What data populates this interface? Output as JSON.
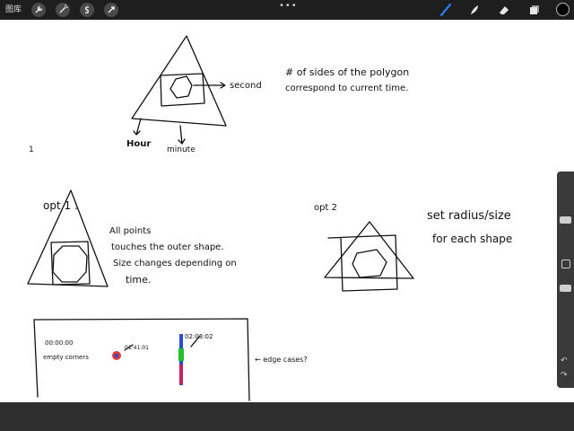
{
  "app": {
    "gallery_label": "图库",
    "menu_dots": "•••"
  },
  "left_tools": [
    "wrench-icon",
    "magic-wand-icon",
    "selection-icon",
    "transform-arrow-icon"
  ],
  "right_tools": [
    "brush-icon",
    "smudge-icon",
    "eraser-icon",
    "layers-icon"
  ],
  "colors": {
    "active_brush": "#2f7bf6",
    "current_color": "#000000"
  },
  "sidebar": {
    "undo_glyph": "↶",
    "redo_glyph": "↷"
  },
  "notes": {
    "second": "second",
    "hour": "Hour",
    "minute": "minute",
    "polygon_line1": "# of sides of the polygon",
    "polygon_line2": "correspond to current time.",
    "mark_1": "1",
    "opt1": "opt 1 :",
    "all_points_1": "All points",
    "all_points_2": "touches the outer shape.",
    "all_points_3": "Size changes depending on",
    "all_points_4": "time.",
    "opt2": "opt 2",
    "radius_1": "set radius/size",
    "radius_2": "for each shape",
    "time_zero": "00:00:00",
    "empty_corners": "empty corners",
    "time_small": "01:41:01",
    "time_right": "02:03:02",
    "edge_cases": "← edge cases?"
  }
}
